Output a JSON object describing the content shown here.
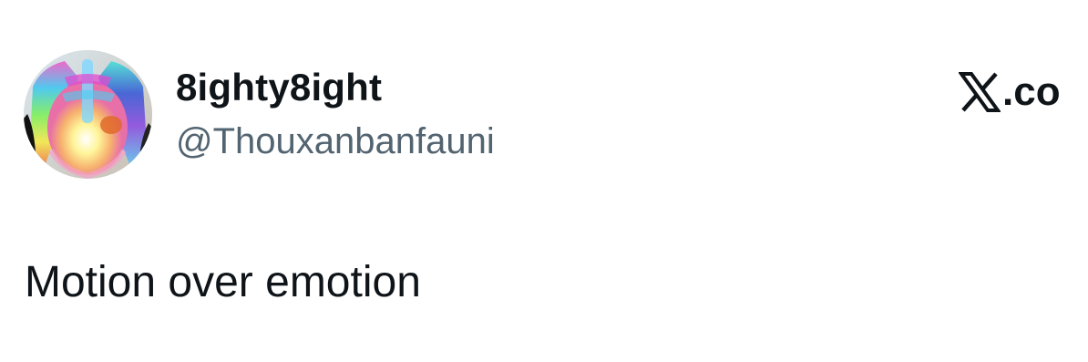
{
  "author": {
    "display_name": "8ighty8ight",
    "handle": "@Thouxanbanfauni",
    "avatar_icon": "xray-avatar-image"
  },
  "source": {
    "logo_icon": "x-logo-icon",
    "text": ".co"
  },
  "tweet": {
    "text": "Motion over emotion"
  },
  "colors": {
    "text_primary": "#0f1419",
    "text_secondary": "#536471",
    "background": "#ffffff"
  }
}
